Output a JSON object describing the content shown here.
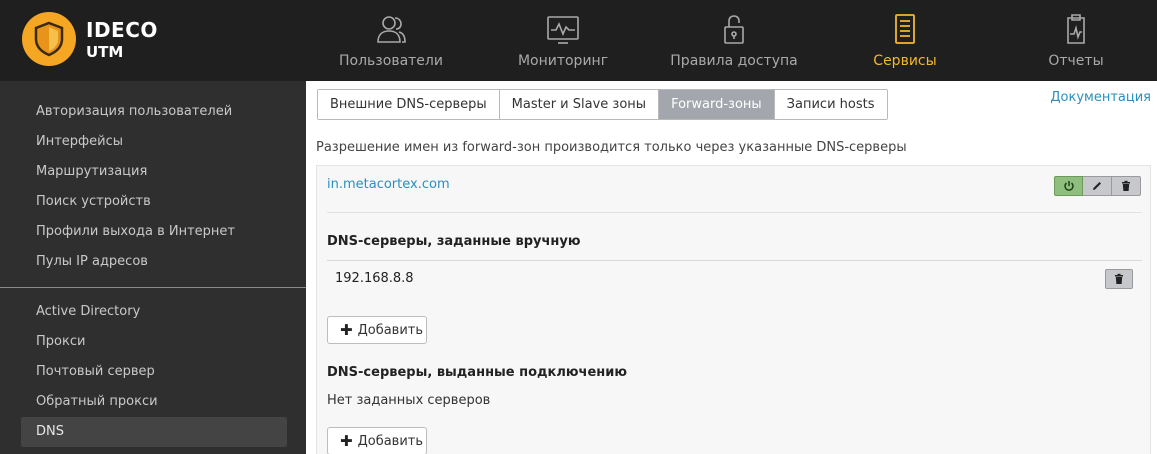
{
  "app": {
    "title": "IDECO",
    "subtitle": "UTM"
  },
  "nav": [
    {
      "label": "Пользователи",
      "icon": "users-icon"
    },
    {
      "label": "Мониторинг",
      "icon": "monitor-icon"
    },
    {
      "label": "Правила доступа",
      "icon": "lock-icon"
    },
    {
      "label": "Сервисы",
      "icon": "server-icon",
      "active": true
    },
    {
      "label": "Отчеты",
      "icon": "report-icon"
    }
  ],
  "sidebar": {
    "items": [
      {
        "label": "Авторизация пользователей"
      },
      {
        "label": "Интерфейсы"
      },
      {
        "label": "Маршрутизация"
      },
      {
        "label": "Поиск устройств"
      },
      {
        "label": "Профили выхода в Интернет"
      },
      {
        "label": "Пулы IP адресов"
      },
      {
        "label": "Active Directory"
      },
      {
        "label": "Прокси"
      },
      {
        "label": "Почтовый сервер"
      },
      {
        "label": "Обратный прокси"
      },
      {
        "label": "DNS",
        "active": true
      }
    ]
  },
  "tabs": [
    {
      "label": "Внешние DNS-серверы"
    },
    {
      "label": "Master и Slave зоны"
    },
    {
      "label": "Forward-зоны",
      "active": true
    },
    {
      "label": "Записи hosts"
    }
  ],
  "doc_link": "Документация",
  "description": "Разрешение имен из forward-зон производится только через указанные DNS-серверы",
  "zone": {
    "name": "in.metacortex.com",
    "manual_title": "DNS-серверы, заданные вручную",
    "manual_servers": [
      "192.168.8.8"
    ],
    "add_label": "Добавить",
    "connection_title": "DNS-серверы, выданные подключению",
    "no_servers": "Нет заданных серверов",
    "add_label_2": "Добавить"
  },
  "colors": {
    "accent": "#f2b632",
    "link": "#2a8fbf",
    "topbar": "#1f1f1f",
    "sidebar": "#2f2f2f"
  }
}
